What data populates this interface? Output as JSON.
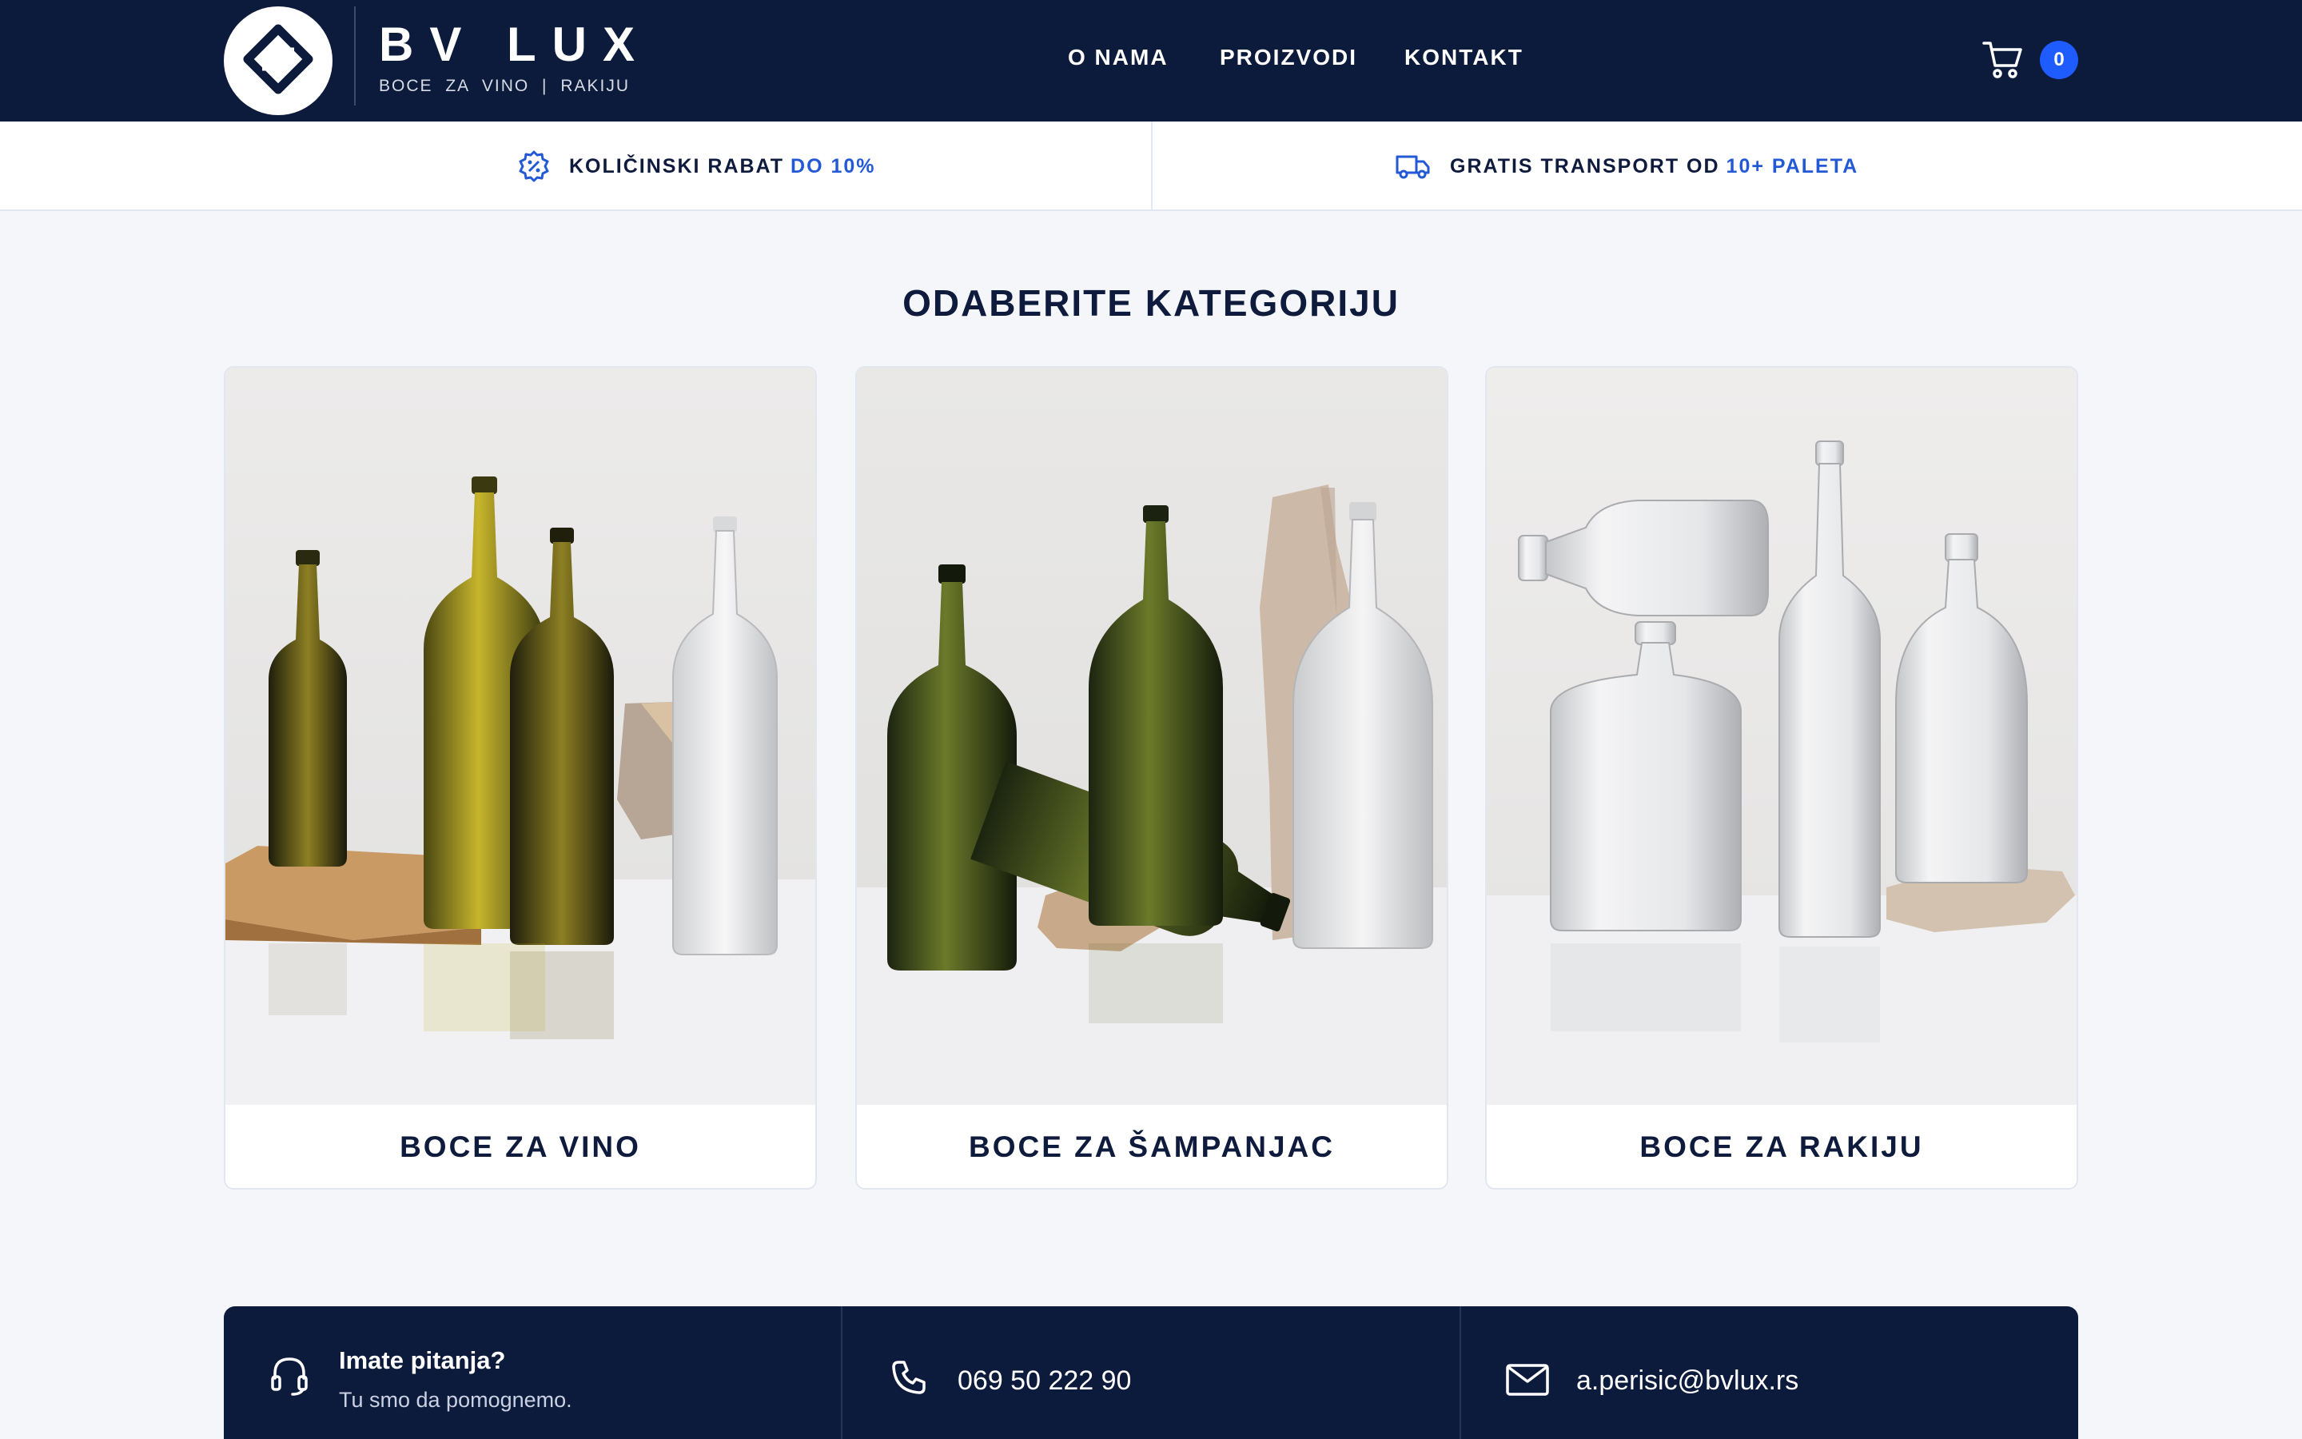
{
  "header": {
    "brand_name": "BV LUX",
    "brand_tagline": "BOCE ZA VINO | RAKIJU",
    "nav": [
      {
        "label": "O NAMA"
      },
      {
        "label": "PROIZVODI"
      },
      {
        "label": "KONTAKT"
      }
    ],
    "cart_count": "0"
  },
  "promo": {
    "discount_label": "KOLIČINSKI RABAT",
    "discount_value": "DO 10%",
    "shipping_label": "GRATIS TRANSPORT OD",
    "shipping_value": "10+ PALETA"
  },
  "categories": {
    "title": "ODABERITE KATEGORIJU",
    "items": [
      {
        "label": "BOCE ZA VINO"
      },
      {
        "label": "BOCE ZA ŠAMPANJAC"
      },
      {
        "label": "BOCE ZA RAKIJU"
      }
    ]
  },
  "contact": {
    "question_title": "Imate pitanja?",
    "question_subtitle": "Tu smo da pomognemo.",
    "phone": "069 50 222 90",
    "email": "a.perisic@bvlux.rs"
  },
  "colors": {
    "navy": "#0c1b3b",
    "accent": "#2459d6",
    "badge": "#1f5cff",
    "page_bg": "#f4f6fa"
  },
  "icons": [
    "logo-mark-icon",
    "percent-badge-icon",
    "truck-icon",
    "cart-icon",
    "headset-icon",
    "phone-icon",
    "mail-icon"
  ]
}
